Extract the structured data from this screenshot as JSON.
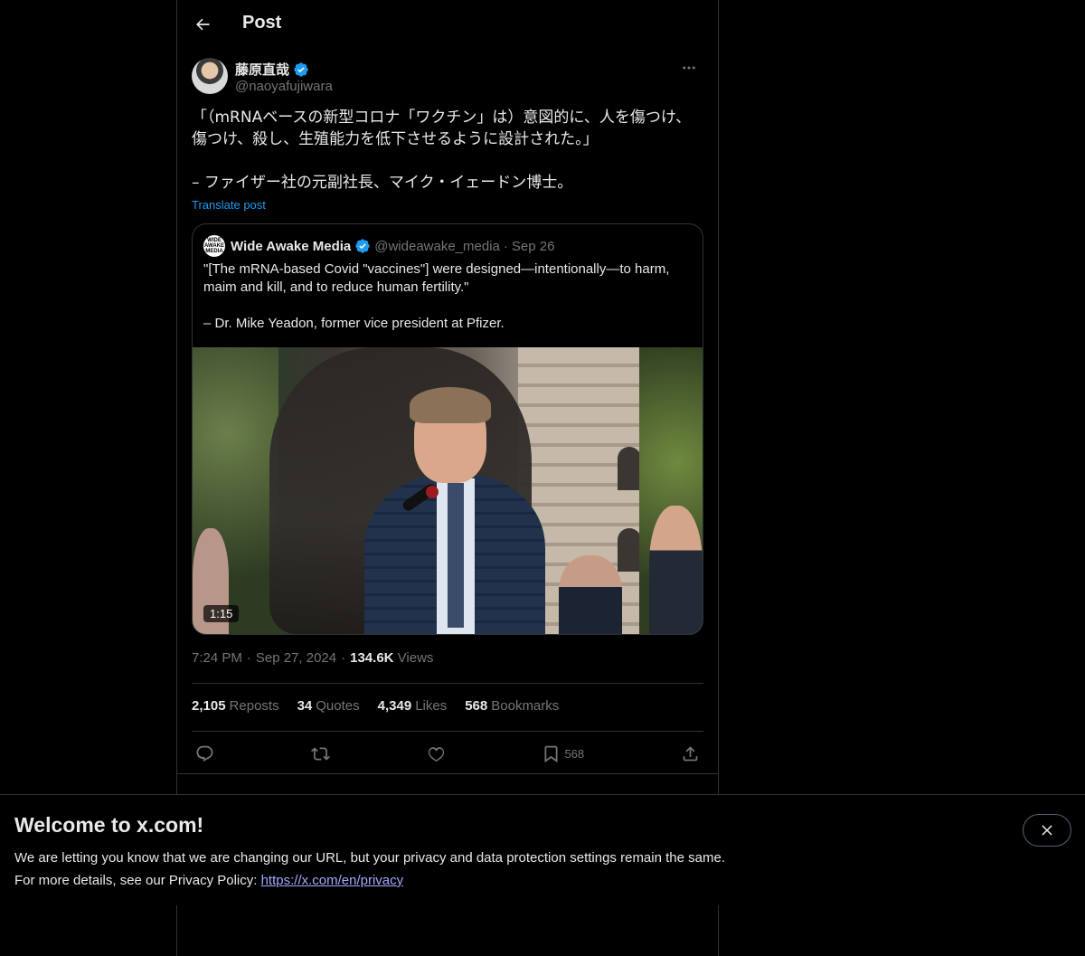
{
  "header": {
    "title": "Post"
  },
  "author": {
    "display_name": "藤原直哉",
    "handle": "@naoyafujiwara"
  },
  "post": {
    "text": "「（mRNAベースの新型コロナ「ワクチン」は）意図的に、人を傷つけ、傷つけ、殺し、生殖能力を低下させるように設計された。」\n\n– ファイザー社の元副社長、マイク・イェードン博士。",
    "translate_label": "Translate post"
  },
  "quote": {
    "avatar_text": "WIDE AWAKE MEDIA",
    "display_name": "Wide Awake Media",
    "handle": "@wideawake_media",
    "separator": "·",
    "date": "Sep 26",
    "text": "\"[The mRNA-based Covid \"vaccines\"] were designed—intentionally—to harm, maim and kill, and to reduce human fertility.\"\n\n– Dr. Mike Yeadon, former vice president at Pfizer.",
    "video_duration": "1:15"
  },
  "meta": {
    "time": "7:24 PM",
    "date": "Sep 27, 2024",
    "sep": "·",
    "views_count": "134.6K",
    "views_label": "Views"
  },
  "stats": {
    "reposts_count": "2,105",
    "reposts_label": "Reposts",
    "quotes_count": "34",
    "quotes_label": "Quotes",
    "likes_count": "4,349",
    "likes_label": "Likes",
    "bookmarks_count": "568",
    "bookmarks_label": "Bookmarks"
  },
  "actions": {
    "bookmark_count": "568"
  },
  "cookie_banner": {
    "title": "Welcome to x.com!",
    "line1": "We are letting you know that we are changing our URL, but your privacy and data protection settings remain the same.",
    "line2_prefix": "For more details, see our Privacy Policy: ",
    "link_text": "https://x.com/en/privacy"
  },
  "colors": {
    "background": "#000000",
    "text": "#e7e9ea",
    "secondary": "#71767b",
    "accent": "#1d9bf0",
    "border": "#2f3336",
    "link": "#a6a6ff"
  }
}
